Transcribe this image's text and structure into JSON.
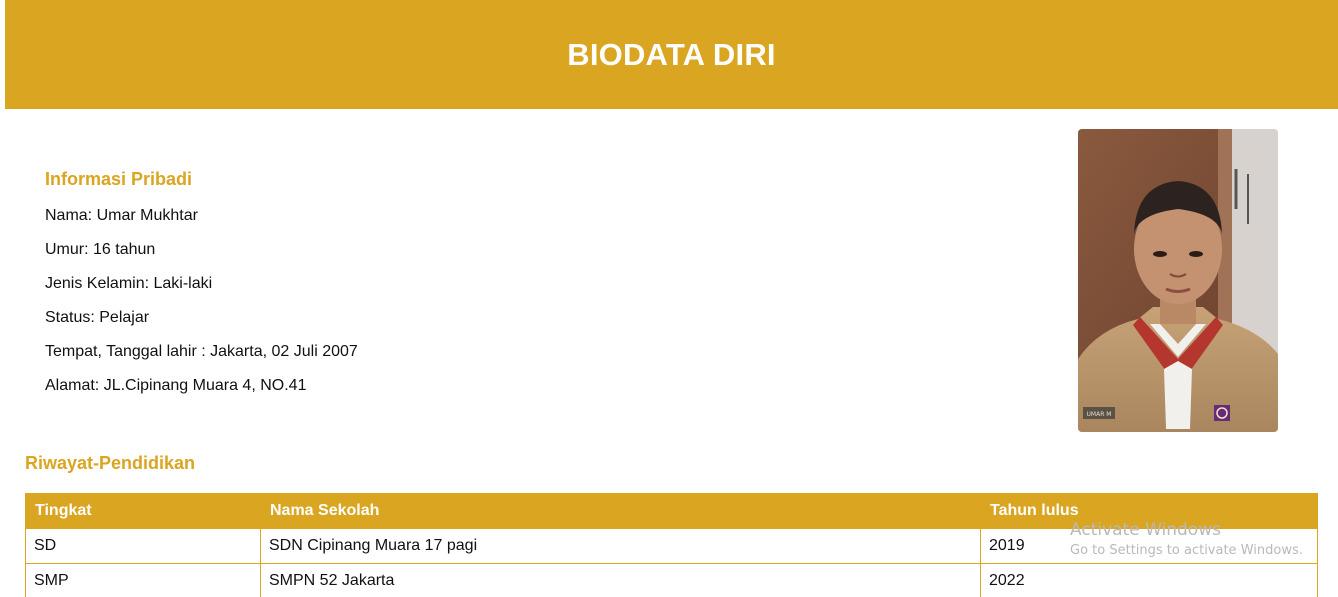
{
  "header": {
    "title": "BIODATA DIRI"
  },
  "personal": {
    "title": "Informasi Pribadi",
    "lines": [
      "Nama: Umar Mukhtar",
      "Umur: 16 tahun",
      "Jenis Kelamin: Laki-laki",
      "Status: Pelajar",
      "Tempat, Tanggal lahir : Jakarta, 02 Juli 2007",
      "Alamat: JL.Cipinang Muara 4, NO.41"
    ]
  },
  "photo": {
    "badge_text": "UMAR M"
  },
  "education": {
    "title": "Riwayat-Pendidikan",
    "headers": [
      "Tingkat",
      "Nama Sekolah",
      "Tahun lulus"
    ],
    "rows": [
      [
        "SD",
        "SDN Cipinang Muara 17 pagi",
        "2019"
      ],
      [
        "SMP",
        "SMPN 52 Jakarta",
        "2022"
      ]
    ]
  },
  "watermark": {
    "line1": "Activate Windows",
    "line2": "Go to Settings to activate Windows."
  },
  "colors": {
    "accent": "#DAA520",
    "text": "#111111",
    "background": "#FFFFFF"
  }
}
